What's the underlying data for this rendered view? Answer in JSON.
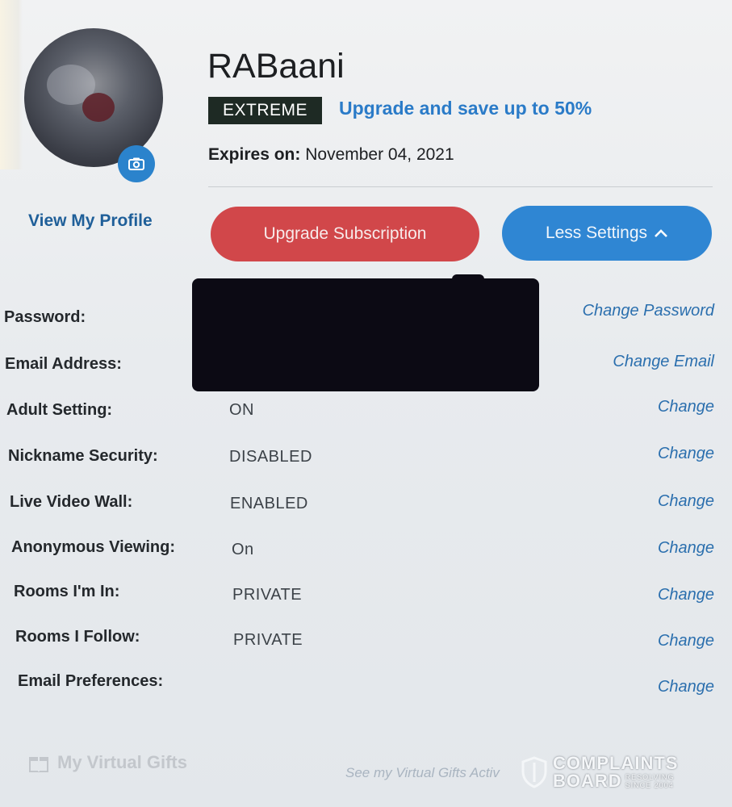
{
  "profile": {
    "username": "RABaani",
    "tier": "EXTREME",
    "upgrade_offer": "Upgrade and save up to 50%",
    "expires_label": "Expires on:",
    "expires_date": "November 04, 2021",
    "view_profile": "View My Profile"
  },
  "buttons": {
    "upgrade": "Upgrade Subscription",
    "less_settings": "Less Settings"
  },
  "settings": [
    {
      "label": "Password:",
      "value": "",
      "action": "Change Password"
    },
    {
      "label": "Email Address:",
      "value": "",
      "action": "Change Email"
    },
    {
      "label": "Adult Setting:",
      "value": "ON",
      "action": "Change"
    },
    {
      "label": "Nickname Security:",
      "value": "DISABLED",
      "action": "Change"
    },
    {
      "label": "Live Video Wall:",
      "value": "ENABLED",
      "action": "Change"
    },
    {
      "label": "Anonymous Viewing:",
      "value": "On",
      "action": "Change"
    },
    {
      "label": "Rooms I'm In:",
      "value": "PRIVATE",
      "action": "Change"
    },
    {
      "label": "Rooms I Follow:",
      "value": "PRIVATE",
      "action": "Change"
    },
    {
      "label": "Email Preferences:",
      "value": "",
      "action": "Change"
    }
  ],
  "gifts": {
    "title": "My Virtual Gifts",
    "link": "See my Virtual Gifts Activ"
  },
  "watermark": {
    "line1": "COMPLAINTS",
    "line2": "BOARD",
    "tag1": "RESOLVING",
    "tag2": "SINCE 2004"
  },
  "colors": {
    "accent_blue": "#2f86d3",
    "upgrade_red": "#d1474a",
    "badge_dark": "#1e2a24"
  }
}
